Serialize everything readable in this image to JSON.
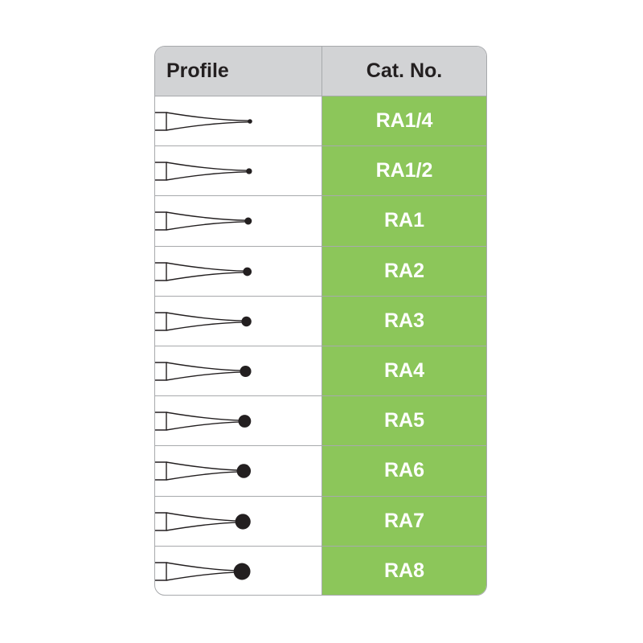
{
  "table": {
    "headers": {
      "profile": "Profile",
      "cat_no": "Cat. No."
    },
    "rows": [
      {
        "cat_no": "RA1/4",
        "tip_size": 1
      },
      {
        "cat_no": "RA1/2",
        "tip_size": 2
      },
      {
        "cat_no": "RA1",
        "tip_size": 3
      },
      {
        "cat_no": "RA2",
        "tip_size": 4
      },
      {
        "cat_no": "RA3",
        "tip_size": 5
      },
      {
        "cat_no": "RA4",
        "tip_size": 6
      },
      {
        "cat_no": "RA5",
        "tip_size": 7
      },
      {
        "cat_no": "RA6",
        "tip_size": 8
      },
      {
        "cat_no": "RA7",
        "tip_size": 9
      },
      {
        "cat_no": "RA8",
        "tip_size": 10
      }
    ],
    "colors": {
      "cat_fill": "#8cc65a",
      "header_fill": "#d2d3d5",
      "border": "#a7a9ac"
    }
  }
}
